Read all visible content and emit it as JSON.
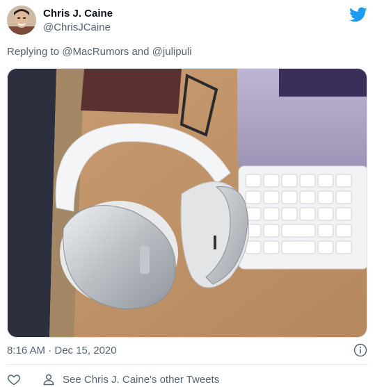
{
  "author": {
    "name": "Chris J. Caine",
    "handle": "@ChrisJCaine",
    "avatar_icon": "profile-photo"
  },
  "brand_icon": "twitter-bird-icon",
  "reply": {
    "prefix": "Replying to",
    "user1": "@MacRumors",
    "conjunction": "and",
    "user2": "@julipuli"
  },
  "media": {
    "description_icon": "headphones-photo"
  },
  "footer": {
    "timestamp": "8:16 AM · Dec 15, 2020",
    "other_tweets_label": "See Chris J. Caine's other Tweets",
    "info_icon": "info-icon",
    "like_icon": "heart-icon",
    "person_icon": "person-icon"
  },
  "colors": {
    "brand": "#1d9bf0",
    "secondary_text": "#536471",
    "primary_text": "#0f1419"
  }
}
